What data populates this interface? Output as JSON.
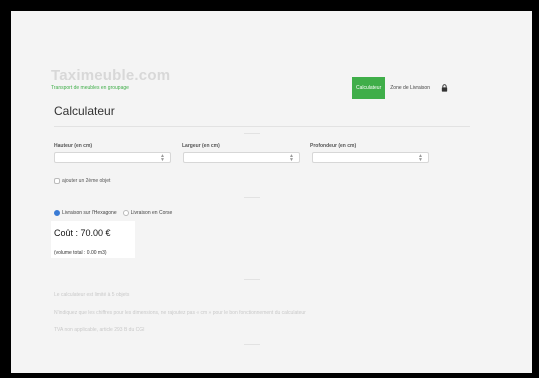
{
  "header": {
    "brand_title": "Taximeuble.com",
    "brand_subtitle": "Transport de meubles en groupage",
    "nav": [
      {
        "label": "Calculateur",
        "active": true
      },
      {
        "label": "Zone de Livraison",
        "active": false
      }
    ],
    "accent_color": "#3fae49",
    "lock_icon": "lock-icon"
  },
  "page": {
    "title": "Calculateur"
  },
  "form": {
    "fields": [
      {
        "label": "Hauteur (en cm)",
        "value": ""
      },
      {
        "label": "Largeur (en cm)",
        "value": ""
      },
      {
        "label": "Profondeur (en cm)",
        "value": ""
      }
    ],
    "add_object_label": "ajouter un 2ème objet",
    "delivery_options": [
      {
        "label": "Livraison sur l'Hexagone",
        "selected": true
      },
      {
        "label": "Livraison en Corse",
        "selected": false
      }
    ]
  },
  "result": {
    "cost": "Coût : 70.00 €",
    "volume": "(volume total : 0.00 m3)"
  },
  "notes": [
    "Le calculateur est limité à 5 objets",
    "N'indiquez que les chiffres pour les dimensions, ne rajoutez pas « cm » pour le bon fonctionnement du calculateur",
    "TVA non applicable, article 293 B du CGI"
  ]
}
